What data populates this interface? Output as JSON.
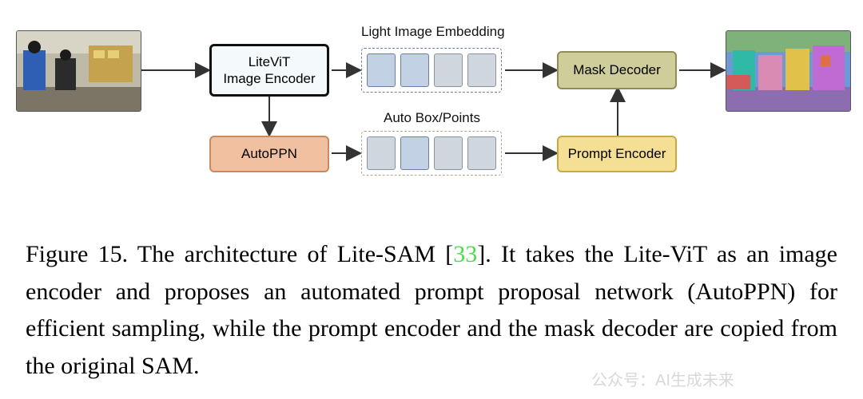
{
  "diagram": {
    "imageEncoder": "LiteViT\nImage Encoder",
    "autoppn": "AutoPPN",
    "maskDecoder": "Mask Decoder",
    "promptEncoder": "Prompt Encoder",
    "embedLabel": "Light Image Embedding",
    "autoLabel": "Auto Box/Points",
    "inputAlt": "store camera input image",
    "outputAlt": "segmentation mask output"
  },
  "caption": {
    "fignum": "Figure 15.",
    "pre": "  The architecture of Lite-SAM [",
    "ref": "33",
    "post": "].  It takes the Lite-ViT as an image encoder and proposes an automated prompt proposal network (AutoPPN) for efficient sampling, while the prompt encoder and the mask decoder are copied from the original SAM."
  },
  "watermark": "公众号：AI生成未来"
}
